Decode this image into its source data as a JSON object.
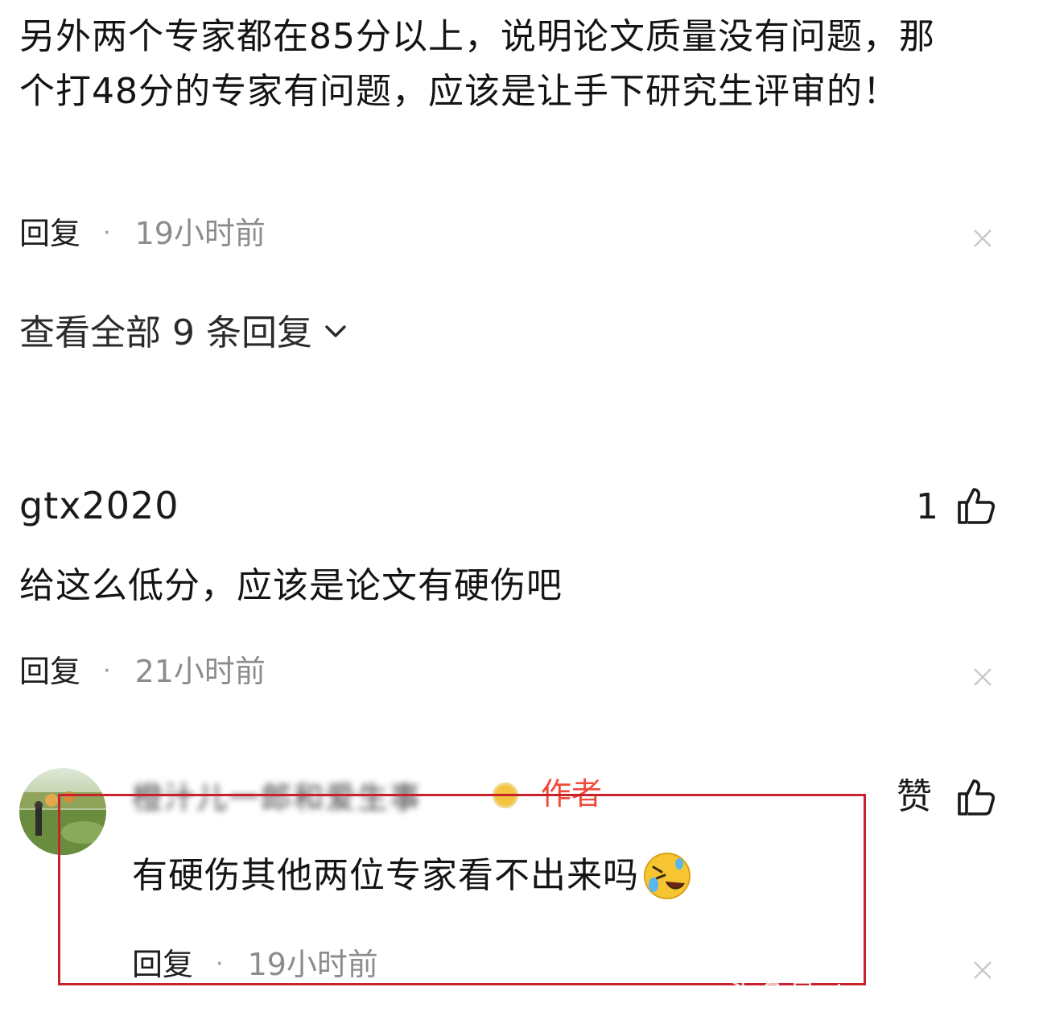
{
  "comment1": {
    "text": "另外两个专家都在85分以上，说明论文质量没有问题，那个打48分的专家有问题，应该是让手下研究生评审的！",
    "reply_label": "回复",
    "dot": "·",
    "time": "19小时前"
  },
  "view_all": {
    "label": "查看全部 9 条回复"
  },
  "comment2": {
    "username": "gtx2020",
    "like_count": "1",
    "text": "给这么低分，应该是论文有硬伤吧",
    "reply_label": "回复",
    "dot": "·",
    "time": "21小时前"
  },
  "reply": {
    "username": "橙汁儿一郎和爱生事",
    "author_badge": "作者",
    "like_label": "赞",
    "text": "有硬伤其他两位专家看不出来吗",
    "emoji": "rolling-on-floor-laughing-icon",
    "reply_label": "回复",
    "dot": "·",
    "time": "19小时前"
  },
  "colors": {
    "highlight_border": "#c8232c",
    "author_badge": "#f04a3a",
    "time_text": "#8c8c8c"
  },
  "watermark": "头条号 / 小北说育"
}
